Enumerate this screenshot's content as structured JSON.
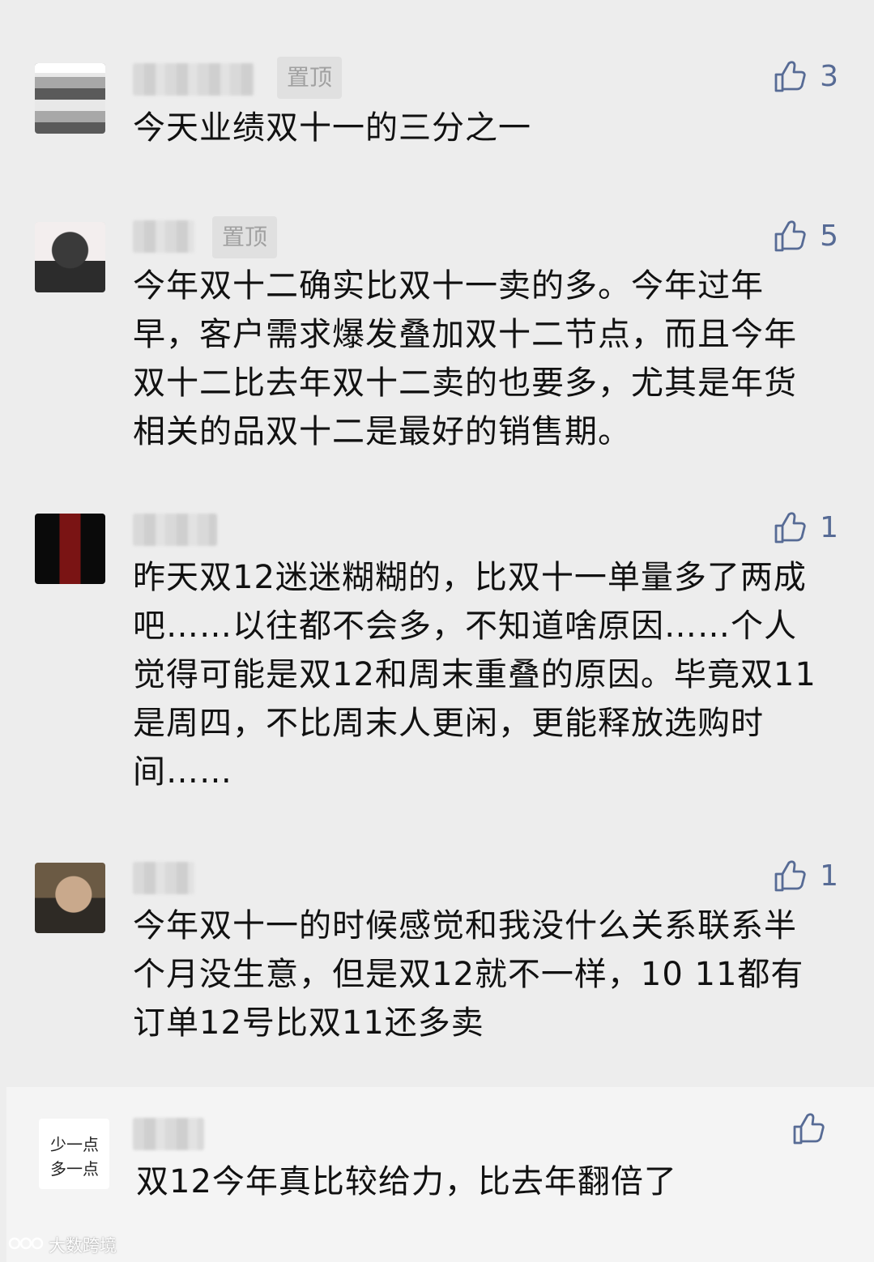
{
  "comments": [
    {
      "pin_label": "置顶",
      "likes": "3",
      "text": "今天业绩双十一的三分之一"
    },
    {
      "pin_label": "置顶",
      "likes": "5",
      "text": "今年双十二确实比双十一卖的多。今年过年早，客户需求爆发叠加双十二节点，而且今年双十二比去年双十二卖的也要多，尤其是年货相关的品双十二是最好的销售期。"
    },
    {
      "likes": "1",
      "text": "昨天双12迷迷糊糊的，比双十一单量多了两成吧……以往都不会多，不知道啥原因……个人觉得可能是双12和周末重叠的原因。毕竟双11是周四，不比周末人更闲，更能释放选购时间……"
    },
    {
      "likes": "1",
      "text": "今年双十一的时候感觉和我没什么关系联系半个月没生意，但是双12就不一样，10 11都有订单12号比双11还多卖"
    },
    {
      "likes": "",
      "text": "双12今年真比较给力，比去年翻倍了",
      "avatar_sticker": [
        "少一点",
        "多一点"
      ]
    }
  ],
  "watermark": "大数跨境",
  "colors": {
    "background": "#ededed",
    "link": "#576b95",
    "text": "#111111",
    "pin_bg": "#e0e0e0"
  },
  "icons": {
    "like": "thumbs-up-icon"
  }
}
